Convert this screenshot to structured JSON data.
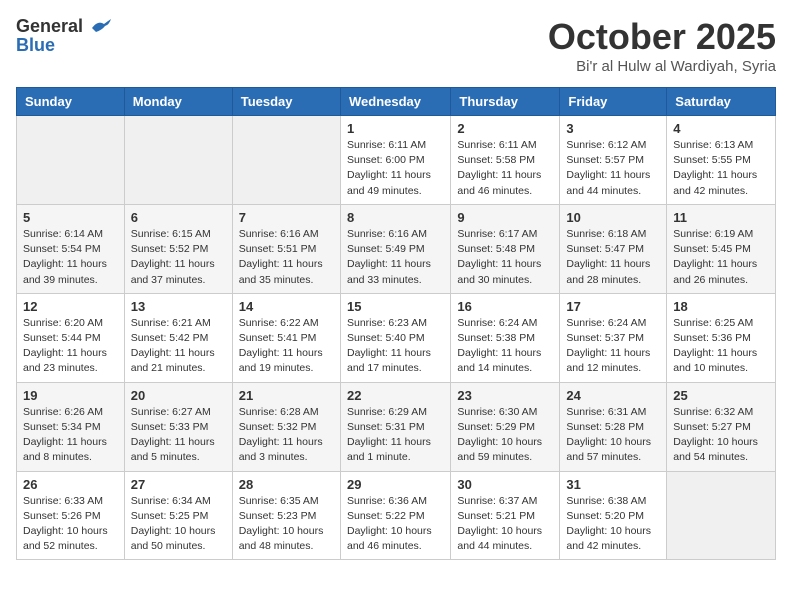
{
  "header": {
    "logo_line1": "General",
    "logo_line2": "Blue",
    "month_title": "October 2025",
    "subtitle": "Bi'r al Hulw al Wardiyah, Syria"
  },
  "days_of_week": [
    "Sunday",
    "Monday",
    "Tuesday",
    "Wednesday",
    "Thursday",
    "Friday",
    "Saturday"
  ],
  "weeks": [
    {
      "bg": "white",
      "days": [
        {
          "num": "",
          "info": ""
        },
        {
          "num": "",
          "info": ""
        },
        {
          "num": "",
          "info": ""
        },
        {
          "num": "1",
          "info": "Sunrise: 6:11 AM\nSunset: 6:00 PM\nDaylight: 11 hours\nand 49 minutes."
        },
        {
          "num": "2",
          "info": "Sunrise: 6:11 AM\nSunset: 5:58 PM\nDaylight: 11 hours\nand 46 minutes."
        },
        {
          "num": "3",
          "info": "Sunrise: 6:12 AM\nSunset: 5:57 PM\nDaylight: 11 hours\nand 44 minutes."
        },
        {
          "num": "4",
          "info": "Sunrise: 6:13 AM\nSunset: 5:55 PM\nDaylight: 11 hours\nand 42 minutes."
        }
      ]
    },
    {
      "bg": "light",
      "days": [
        {
          "num": "5",
          "info": "Sunrise: 6:14 AM\nSunset: 5:54 PM\nDaylight: 11 hours\nand 39 minutes."
        },
        {
          "num": "6",
          "info": "Sunrise: 6:15 AM\nSunset: 5:52 PM\nDaylight: 11 hours\nand 37 minutes."
        },
        {
          "num": "7",
          "info": "Sunrise: 6:16 AM\nSunset: 5:51 PM\nDaylight: 11 hours\nand 35 minutes."
        },
        {
          "num": "8",
          "info": "Sunrise: 6:16 AM\nSunset: 5:49 PM\nDaylight: 11 hours\nand 33 minutes."
        },
        {
          "num": "9",
          "info": "Sunrise: 6:17 AM\nSunset: 5:48 PM\nDaylight: 11 hours\nand 30 minutes."
        },
        {
          "num": "10",
          "info": "Sunrise: 6:18 AM\nSunset: 5:47 PM\nDaylight: 11 hours\nand 28 minutes."
        },
        {
          "num": "11",
          "info": "Sunrise: 6:19 AM\nSunset: 5:45 PM\nDaylight: 11 hours\nand 26 minutes."
        }
      ]
    },
    {
      "bg": "white",
      "days": [
        {
          "num": "12",
          "info": "Sunrise: 6:20 AM\nSunset: 5:44 PM\nDaylight: 11 hours\nand 23 minutes."
        },
        {
          "num": "13",
          "info": "Sunrise: 6:21 AM\nSunset: 5:42 PM\nDaylight: 11 hours\nand 21 minutes."
        },
        {
          "num": "14",
          "info": "Sunrise: 6:22 AM\nSunset: 5:41 PM\nDaylight: 11 hours\nand 19 minutes."
        },
        {
          "num": "15",
          "info": "Sunrise: 6:23 AM\nSunset: 5:40 PM\nDaylight: 11 hours\nand 17 minutes."
        },
        {
          "num": "16",
          "info": "Sunrise: 6:24 AM\nSunset: 5:38 PM\nDaylight: 11 hours\nand 14 minutes."
        },
        {
          "num": "17",
          "info": "Sunrise: 6:24 AM\nSunset: 5:37 PM\nDaylight: 11 hours\nand 12 minutes."
        },
        {
          "num": "18",
          "info": "Sunrise: 6:25 AM\nSunset: 5:36 PM\nDaylight: 11 hours\nand 10 minutes."
        }
      ]
    },
    {
      "bg": "light",
      "days": [
        {
          "num": "19",
          "info": "Sunrise: 6:26 AM\nSunset: 5:34 PM\nDaylight: 11 hours\nand 8 minutes."
        },
        {
          "num": "20",
          "info": "Sunrise: 6:27 AM\nSunset: 5:33 PM\nDaylight: 11 hours\nand 5 minutes."
        },
        {
          "num": "21",
          "info": "Sunrise: 6:28 AM\nSunset: 5:32 PM\nDaylight: 11 hours\nand 3 minutes."
        },
        {
          "num": "22",
          "info": "Sunrise: 6:29 AM\nSunset: 5:31 PM\nDaylight: 11 hours\nand 1 minute."
        },
        {
          "num": "23",
          "info": "Sunrise: 6:30 AM\nSunset: 5:29 PM\nDaylight: 10 hours\nand 59 minutes."
        },
        {
          "num": "24",
          "info": "Sunrise: 6:31 AM\nSunset: 5:28 PM\nDaylight: 10 hours\nand 57 minutes."
        },
        {
          "num": "25",
          "info": "Sunrise: 6:32 AM\nSunset: 5:27 PM\nDaylight: 10 hours\nand 54 minutes."
        }
      ]
    },
    {
      "bg": "white",
      "days": [
        {
          "num": "26",
          "info": "Sunrise: 6:33 AM\nSunset: 5:26 PM\nDaylight: 10 hours\nand 52 minutes."
        },
        {
          "num": "27",
          "info": "Sunrise: 6:34 AM\nSunset: 5:25 PM\nDaylight: 10 hours\nand 50 minutes."
        },
        {
          "num": "28",
          "info": "Sunrise: 6:35 AM\nSunset: 5:23 PM\nDaylight: 10 hours\nand 48 minutes."
        },
        {
          "num": "29",
          "info": "Sunrise: 6:36 AM\nSunset: 5:22 PM\nDaylight: 10 hours\nand 46 minutes."
        },
        {
          "num": "30",
          "info": "Sunrise: 6:37 AM\nSunset: 5:21 PM\nDaylight: 10 hours\nand 44 minutes."
        },
        {
          "num": "31",
          "info": "Sunrise: 6:38 AM\nSunset: 5:20 PM\nDaylight: 10 hours\nand 42 minutes."
        },
        {
          "num": "",
          "info": ""
        }
      ]
    }
  ]
}
